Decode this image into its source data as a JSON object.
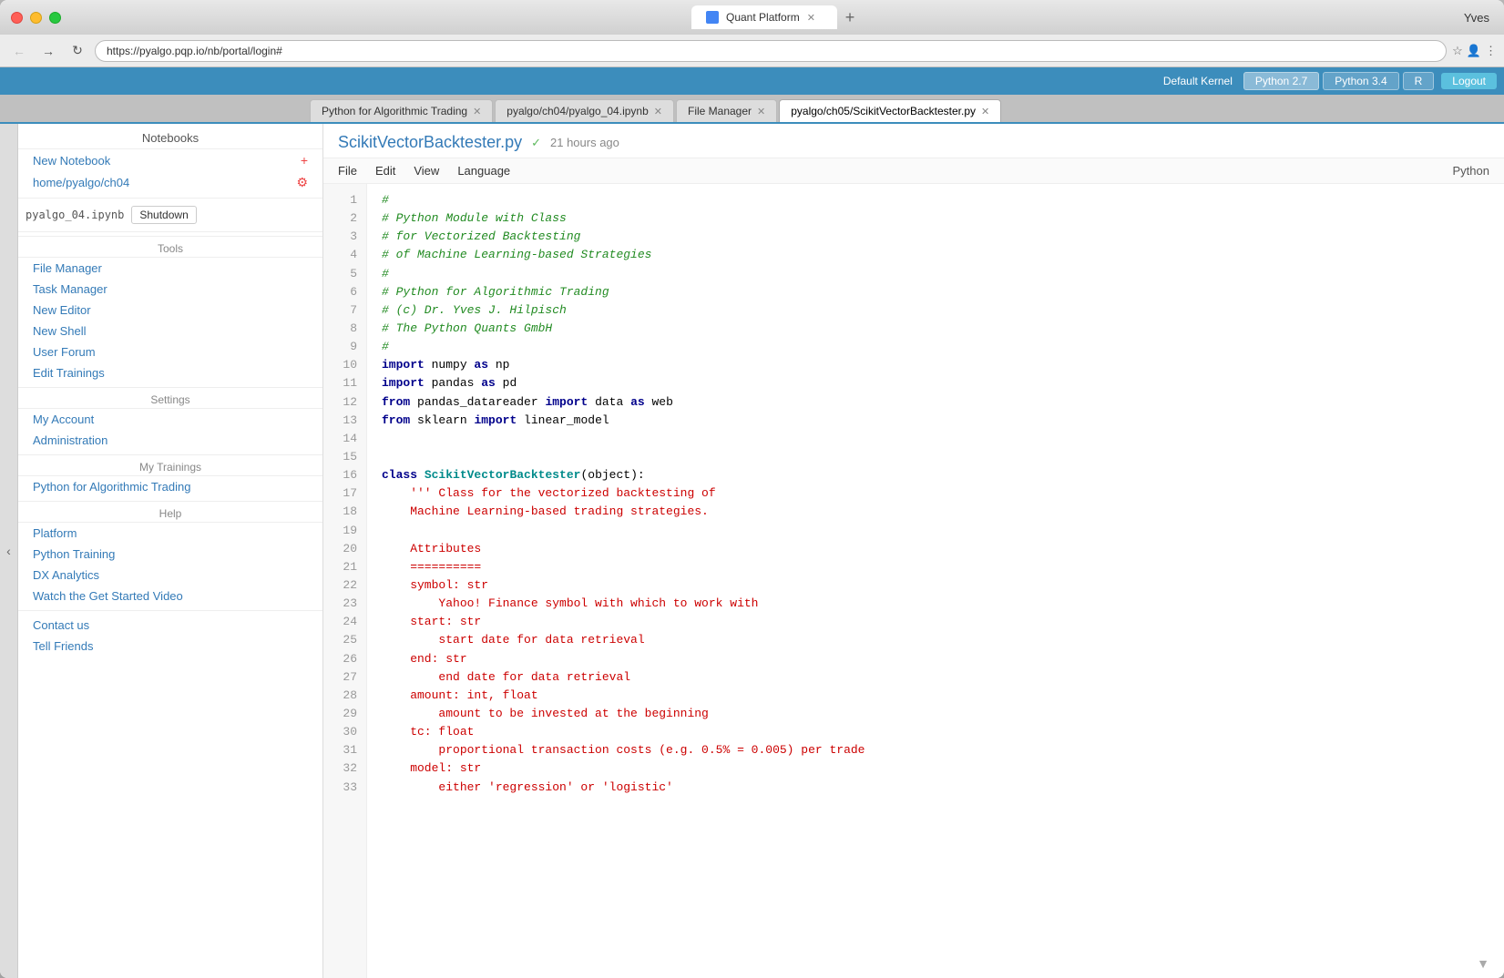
{
  "window": {
    "title": "Quant Platform",
    "user": "Yves"
  },
  "addressbar": {
    "url": "https://pyalgo.pqp.io/nb/portal/login#"
  },
  "kernelbar": {
    "default_kernel_label": "Default Kernel",
    "btns": [
      "Python 2.7",
      "Python 3.4",
      "R"
    ],
    "active_btn": "Python 2.7",
    "logout_label": "Logout"
  },
  "tabs": [
    {
      "label": "Python for Algorithmic Trading",
      "active": false,
      "closable": true
    },
    {
      "label": "pyalgo/ch04/pyalgo_04.ipynb",
      "active": false,
      "closable": true
    },
    {
      "label": "File Manager",
      "active": false,
      "closable": true
    },
    {
      "label": "pyalgo/ch05/ScikitVectorBacktester.py",
      "active": true,
      "closable": true
    }
  ],
  "sidebar": {
    "notebooks_title": "Notebooks",
    "new_notebook_label": "New Notebook",
    "new_notebook_icon": "+",
    "home_path": "home/pyalgo/ch04",
    "home_icon": "⚙",
    "kernel_file": "pyalgo_04.ipynb",
    "shutdown_label": "Shutdown",
    "tools_title": "Tools",
    "tools_items": [
      "File Manager",
      "Task Manager",
      "New Editor",
      "New Shell",
      "User Forum",
      "Edit Trainings"
    ],
    "settings_title": "Settings",
    "settings_items": [
      "My Account",
      "Administration"
    ],
    "my_trainings_title": "My Trainings",
    "my_trainings_items": [
      "Python for Algorithmic Trading"
    ],
    "help_title": "Help",
    "help_items": [
      "Platform",
      "Python Training",
      "DX Analytics",
      "Watch the Get Started Video"
    ],
    "contact_items": [
      "Contact us",
      "Tell Friends"
    ]
  },
  "editor": {
    "filename": "ScikitVectorBacktester.py",
    "saved_icon": "✓",
    "time_ago": "21 hours ago",
    "menu": [
      "File",
      "Edit",
      "View",
      "Language"
    ],
    "language": "Python",
    "code_lines": [
      {
        "num": 1,
        "code": "#",
        "type": "comment"
      },
      {
        "num": 2,
        "code": "# Python Module with Class",
        "type": "comment"
      },
      {
        "num": 3,
        "code": "# for Vectorized Backtesting",
        "type": "comment"
      },
      {
        "num": 4,
        "code": "# of Machine Learning-based Strategies",
        "type": "comment"
      },
      {
        "num": 5,
        "code": "#",
        "type": "comment"
      },
      {
        "num": 6,
        "code": "# Python for Algorithmic Trading",
        "type": "comment"
      },
      {
        "num": 7,
        "code": "# (c) Dr. Yves J. Hilpisch",
        "type": "comment"
      },
      {
        "num": 8,
        "code": "# The Python Quants GmbH",
        "type": "comment"
      },
      {
        "num": 9,
        "code": "#",
        "type": "comment"
      },
      {
        "num": 10,
        "code": "import numpy as np",
        "type": "import"
      },
      {
        "num": 11,
        "code": "import pandas as pd",
        "type": "import"
      },
      {
        "num": 12,
        "code": "from pandas_datareader import data as web",
        "type": "import"
      },
      {
        "num": 13,
        "code": "from sklearn import linear_model",
        "type": "import"
      },
      {
        "num": 14,
        "code": "",
        "type": "blank"
      },
      {
        "num": 15,
        "code": "",
        "type": "blank"
      },
      {
        "num": 16,
        "code": "class ScikitVectorBacktester(object):",
        "type": "class"
      },
      {
        "num": 17,
        "code": "    ''' Class for the vectorized backtesting of",
        "type": "docstring"
      },
      {
        "num": 18,
        "code": "    Machine Learning-based trading strategies.",
        "type": "docstring"
      },
      {
        "num": 19,
        "code": "",
        "type": "blank"
      },
      {
        "num": 20,
        "code": "    Attributes",
        "type": "docstring"
      },
      {
        "num": 21,
        "code": "    ==========",
        "type": "docstring"
      },
      {
        "num": 22,
        "code": "    symbol: str",
        "type": "docstring"
      },
      {
        "num": 23,
        "code": "        Yahoo! Finance symbol with which to work with",
        "type": "docstring"
      },
      {
        "num": 24,
        "code": "    start: str",
        "type": "docstring"
      },
      {
        "num": 25,
        "code": "        start date for data retrieval",
        "type": "docstring"
      },
      {
        "num": 26,
        "code": "    end: str",
        "type": "docstring"
      },
      {
        "num": 27,
        "code": "        end date for data retrieval",
        "type": "docstring"
      },
      {
        "num": 28,
        "code": "    amount: int, float",
        "type": "docstring"
      },
      {
        "num": 29,
        "code": "        amount to be invested at the beginning",
        "type": "docstring"
      },
      {
        "num": 30,
        "code": "    tc: float",
        "type": "docstring"
      },
      {
        "num": 31,
        "code": "        proportional transaction costs (e.g. 0.5% = 0.005) per trade",
        "type": "docstring"
      },
      {
        "num": 32,
        "code": "    model: str",
        "type": "docstring"
      },
      {
        "num": 33,
        "code": "        either 'regression' or 'logistic'",
        "type": "docstring"
      }
    ]
  }
}
